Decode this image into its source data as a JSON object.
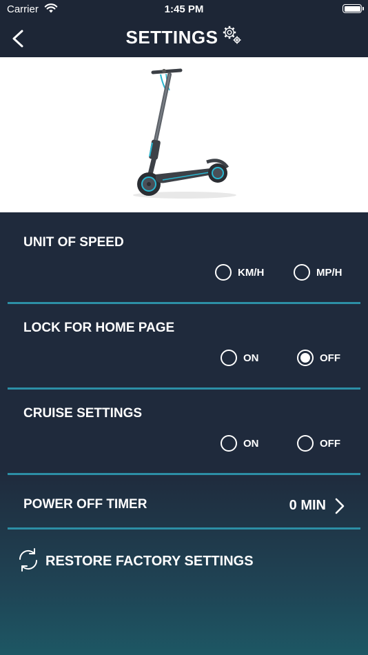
{
  "status_bar": {
    "carrier": "Carrier",
    "time": "1:45 PM"
  },
  "header": {
    "title": "SETTINGS",
    "back_icon": "chevron-left-icon",
    "title_icon": "gear-icon"
  },
  "hero": {
    "image": "electric-scooter-image"
  },
  "speed_unit": {
    "label": "UNIT OF SPEED",
    "options": [
      {
        "label": "KM/H",
        "selected": false
      },
      {
        "label": "MP/H",
        "selected": false
      }
    ]
  },
  "home_lock": {
    "label": "LOCK FOR HOME PAGE",
    "options": [
      {
        "label": "ON",
        "selected": false
      },
      {
        "label": "OFF",
        "selected": true
      }
    ]
  },
  "cruise": {
    "label": "CRUISE SETTINGS",
    "options": [
      {
        "label": "ON",
        "selected": false
      },
      {
        "label": "OFF",
        "selected": false
      }
    ]
  },
  "power_off_timer": {
    "label": "POWER OFF TIMER",
    "value": "0 MIN"
  },
  "restore": {
    "label": "RESTORE FACTORY SETTINGS",
    "icon": "refresh-icon"
  },
  "colors": {
    "background": "#1f2a3c",
    "accent": "#2c8fa6",
    "text": "#ffffff"
  }
}
